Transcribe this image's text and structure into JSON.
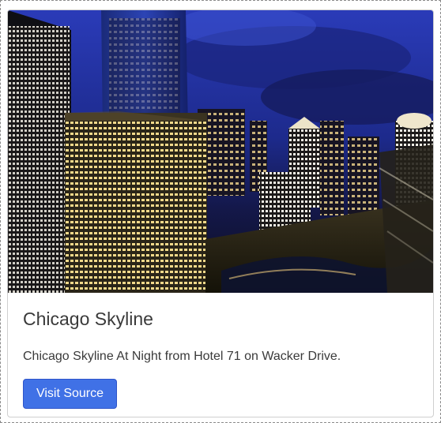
{
  "card": {
    "image_alt": "Chicago Skyline",
    "title": "Chicago Skyline",
    "description": "Chicago Skyline At Night from Hotel 71 on Wacker Drive.",
    "button_label": "Visit Source"
  },
  "colors": {
    "button_bg": "#4071e6",
    "sky": "#2b3fae",
    "text": "#3a3a3a"
  }
}
